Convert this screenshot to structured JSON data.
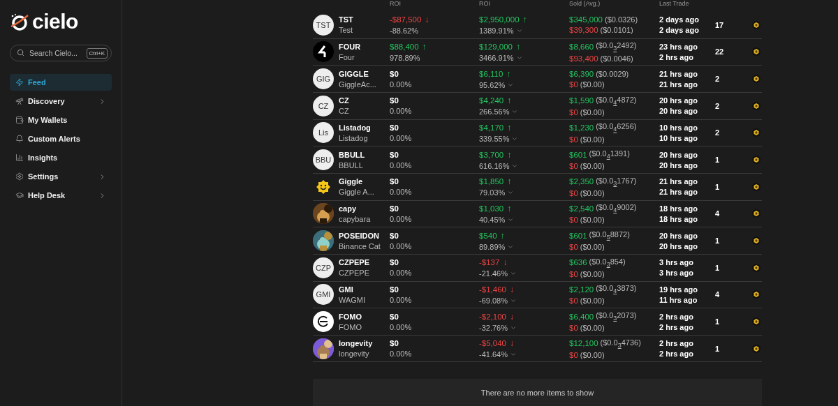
{
  "sidebar": {
    "logo": "cielo",
    "search": {
      "placeholder": "Search Cielo...",
      "shortcut": "Ctrl+K"
    },
    "items": [
      {
        "label": "Feed",
        "selected": true,
        "has_submenu": false
      },
      {
        "label": "Discovery",
        "selected": false,
        "has_submenu": true
      },
      {
        "label": "My Wallets",
        "selected": false,
        "has_submenu": false
      },
      {
        "label": "Custom Alerts",
        "selected": false,
        "has_submenu": false
      },
      {
        "label": "Insights",
        "selected": false,
        "has_submenu": false
      },
      {
        "label": "Settings",
        "selected": false,
        "has_submenu": true
      },
      {
        "label": "Help Desk",
        "selected": false,
        "has_submenu": true
      }
    ]
  },
  "table": {
    "columns": [
      "ROI",
      "ROI",
      "Sold (Avg.)",
      "Last Trade"
    ],
    "rows": [
      {
        "symbol": "TST",
        "name": "Test",
        "avatar": {
          "kind": "initials",
          "text": "TST"
        },
        "realized": {
          "value": "-$87,500",
          "arrow": "↓",
          "color": "#ef4444",
          "pct": "-88.62%"
        },
        "unrealized": {
          "value": "$2,950,000",
          "arrow": "↑",
          "color": "#22c55e",
          "pct": "1389.91%"
        },
        "bought": "$345,000",
        "bought_avg": "($0.0326)",
        "sold": "$39,300",
        "sold_avg": "($0.0101)",
        "first_trade": "2 days ago",
        "last_trade": "2 days ago",
        "count": "17"
      },
      {
        "symbol": "FOUR",
        "name": "Four",
        "avatar": {
          "kind": "dark"
        },
        "realized": {
          "value": "$88,400",
          "arrow": "↑",
          "color": "#22c55e",
          "pct": "978.89%"
        },
        "unrealized": {
          "value": "$129,000",
          "arrow": "↑",
          "color": "#22c55e",
          "pct": "3466.91%"
        },
        "bought": "$8,660",
        "bought_avg": "($0.0$_{3}$2492)",
        "sold": "$93,400",
        "sold_avg": "($0.0046)",
        "first_trade": "23 hrs ago",
        "last_trade": "2 hrs ago",
        "count": "22"
      },
      {
        "symbol": "GIGGLE",
        "name": "GiggleAc...",
        "avatar": {
          "kind": "initials",
          "text": "GIG"
        },
        "realized": {
          "value": "$0",
          "color": "#ffffff",
          "pct": "0.00%"
        },
        "unrealized": {
          "value": "$6,110",
          "arrow": "↑",
          "color": "#22c55e",
          "pct": "95.62%"
        },
        "bought": "$6,390",
        "bought_avg": "($0.0029)",
        "sold": "$0",
        "sold_avg": "($0.00)",
        "first_trade": "21 hrs ago",
        "last_trade": "21 hrs ago",
        "count": "2"
      },
      {
        "symbol": "CZ",
        "name": "CZ",
        "avatar": {
          "kind": "initials",
          "text": "CZ"
        },
        "realized": {
          "value": "$0",
          "color": "#ffffff",
          "pct": "0.00%"
        },
        "unrealized": {
          "value": "$4,240",
          "arrow": "↑",
          "color": "#22c55e",
          "pct": "266.56%"
        },
        "bought": "$1,590",
        "bought_avg": "($0.0$_{4}$4872)",
        "sold": "$0",
        "sold_avg": "($0.00)",
        "first_trade": "20 hrs ago",
        "last_trade": "20 hrs ago",
        "count": "2"
      },
      {
        "symbol": "Listadog",
        "name": "Listadog",
        "avatar": {
          "kind": "initials",
          "text": "Lis"
        },
        "realized": {
          "value": "$0",
          "color": "#ffffff",
          "pct": "0.00%"
        },
        "unrealized": {
          "value": "$4,170",
          "arrow": "↑",
          "color": "#22c55e",
          "pct": "339.55%"
        },
        "bought": "$1,230",
        "bought_avg": "($0.0$_{4}$6256)",
        "sold": "$0",
        "sold_avg": "($0.00)",
        "first_trade": "10 hrs ago",
        "last_trade": "10 hrs ago",
        "count": "2"
      },
      {
        "symbol": "BBULL",
        "name": "BBULL",
        "avatar": {
          "kind": "initials",
          "text": "BBU"
        },
        "realized": {
          "value": "$0",
          "color": "#ffffff",
          "pct": "0.00%"
        },
        "unrealized": {
          "value": "$3,700",
          "arrow": "↑",
          "color": "#22c55e",
          "pct": "616.16%"
        },
        "bought": "$601",
        "bought_avg": "($0.0$_{4}$1391)",
        "sold": "$0",
        "sold_avg": "($0.00)",
        "first_trade": "20 hrs ago",
        "last_trade": "20 hrs ago",
        "count": "1"
      },
      {
        "symbol": "Giggle",
        "name": "Giggle A...",
        "avatar": {
          "kind": "smiley"
        },
        "realized": {
          "value": "$0",
          "color": "#ffffff",
          "pct": "0.00%"
        },
        "unrealized": {
          "value": "$1,850",
          "arrow": "↑",
          "color": "#22c55e",
          "pct": "79.03%"
        },
        "bought": "$2,350",
        "bought_avg": "($0.0$_{3}$1767)",
        "sold": "$0",
        "sold_avg": "($0.00)",
        "first_trade": "21 hrs ago",
        "last_trade": "21 hrs ago",
        "count": "1"
      },
      {
        "symbol": "capy",
        "name": "capybara",
        "realized": {
          "value": "$0",
          "color": "#ffffff",
          "pct": "0.00%"
        },
        "unrealized": {
          "value": "$1,030",
          "arrow": "↑",
          "color": "#22c55e",
          "pct": "40.45%"
        },
        "bought": "$2,540",
        "bought_avg": "($0.0$_{4}$9002)",
        "sold": "$0",
        "sold_avg": "($0.00)",
        "first_trade": "18 hrs ago",
        "last_trade": "18 hrs ago",
        "count": "4"
      },
      {
        "symbol": "POSEIDON",
        "name": "Binance Cat",
        "realized": {
          "value": "$0",
          "color": "#ffffff",
          "pct": "0.00%"
        },
        "unrealized": {
          "value": "$540",
          "arrow": "↑",
          "color": "#22c55e",
          "pct": "89.89%"
        },
        "bought": "$601",
        "bought_avg": "($0.0$_{5}$8872)",
        "sold": "$0",
        "sold_avg": "($0.00)",
        "first_trade": "20 hrs ago",
        "last_trade": "20 hrs ago",
        "count": "1"
      },
      {
        "symbol": "CZPEPE",
        "name": "CZPEPE",
        "avatar": {
          "kind": "initials",
          "text": "CZP"
        },
        "realized": {
          "value": "$0",
          "color": "#ffffff",
          "pct": "0.00%"
        },
        "unrealized": {
          "value": "-$137",
          "arrow": "↓",
          "color": "#ef4444",
          "pct": "-21.46%"
        },
        "bought": "$636",
        "bought_avg": "($0.0$_{3}$854)",
        "sold": "$0",
        "sold_avg": "($0.00)",
        "first_trade": "3 hrs ago",
        "last_trade": "3 hrs ago",
        "count": "1"
      },
      {
        "symbol": "GMI",
        "name": "WAGMI",
        "avatar": {
          "kind": "initials",
          "text": "GMI"
        },
        "realized": {
          "value": "$0",
          "color": "#ffffff",
          "pct": "0.00%"
        },
        "unrealized": {
          "value": "-$1,460",
          "arrow": "↓",
          "color": "#ef4444",
          "pct": "-69.08%"
        },
        "bought": "$2,120",
        "bought_avg": "($0.0$_{4}$3873)",
        "sold": "$0",
        "sold_avg": "($0.00)",
        "first_trade": "19 hrs ago",
        "last_trade": "11 hrs ago",
        "count": "4"
      },
      {
        "symbol": "FOMO",
        "name": "FOMO",
        "avatar": {
          "kind": "ring"
        },
        "realized": {
          "value": "$0",
          "color": "#ffffff",
          "pct": "0.00%"
        },
        "unrealized": {
          "value": "-$2,100",
          "arrow": "↓",
          "color": "#ef4444",
          "pct": "-32.76%"
        },
        "bought": "$6,400",
        "bought_avg": "($0.0$_{3}$2073)",
        "sold": "$0",
        "sold_avg": "($0.00)",
        "first_trade": "2 hrs ago",
        "last_trade": "2 hrs ago",
        "count": "1"
      },
      {
        "symbol": "longevity",
        "name": "longevity",
        "realized": {
          "value": "$0",
          "color": "#ffffff",
          "pct": "0.00%"
        },
        "unrealized": {
          "value": "-$5,040",
          "arrow": "↓",
          "color": "#ef4444",
          "pct": "-41.64%"
        },
        "bought": "$12,100",
        "bought_avg": "($0.0$_{3}$4736)",
        "sold": "$0",
        "sold_avg": "($0.00)",
        "first_trade": "2 hrs ago",
        "last_trade": "2 hrs ago",
        "count": "1"
      }
    ],
    "end_message": "There are no more items to show"
  }
}
